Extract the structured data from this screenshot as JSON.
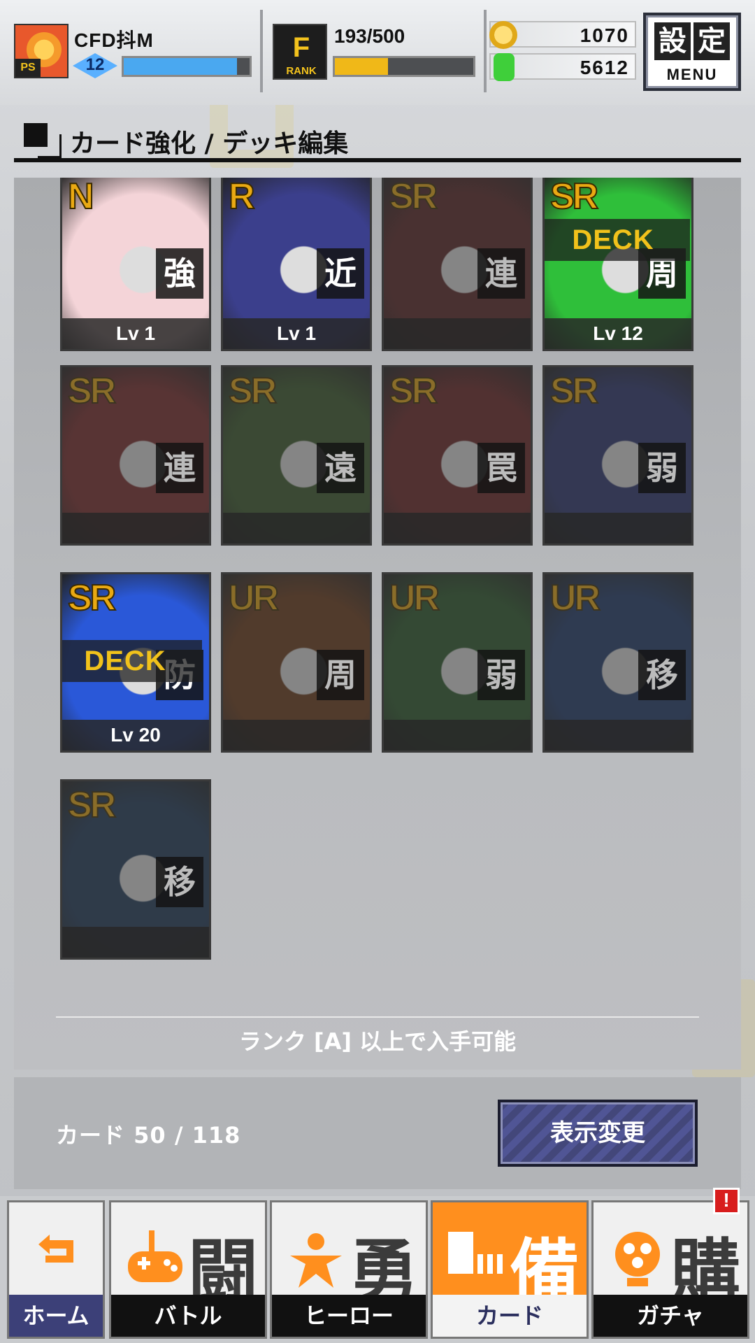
{
  "header": {
    "player_name": "CFD抖M",
    "level": "12",
    "exp_fraction": 0.9,
    "rank_progress": "193/500",
    "rank_fraction": 0.386,
    "rank_icon_letter": "F",
    "rank_icon_label": "RANK",
    "gold": "1070",
    "energy": "5612",
    "menu_kanji": [
      "設",
      "定"
    ],
    "menu_label": "MENU",
    "badge_ps": "PS"
  },
  "section": {
    "title": "カード強化 / デッキ編集"
  },
  "cards": [
    {
      "rarity": "N",
      "type": "強",
      "level": "Lv 1",
      "deck": "",
      "owned": true,
      "color": "#f4d4d8"
    },
    {
      "rarity": "R",
      "type": "近",
      "level": "Lv 1",
      "deck": "",
      "owned": true,
      "color": "#3b3f8c"
    },
    {
      "rarity": "SR",
      "type": "連",
      "level": "",
      "deck": "",
      "owned": false,
      "color": "#5a2424"
    },
    {
      "rarity": "SR",
      "type": "周",
      "level": "Lv 12",
      "deck": "DECK",
      "owned": true,
      "color": "#2fbf3a"
    },
    {
      "rarity": "SR",
      "type": "連",
      "level": "",
      "deck": "",
      "owned": false,
      "color": "#7a2a2a"
    },
    {
      "rarity": "SR",
      "type": "遠",
      "level": "",
      "deck": "",
      "owned": false,
      "color": "#3a5a2a"
    },
    {
      "rarity": "SR",
      "type": "罠",
      "level": "",
      "deck": "",
      "owned": false,
      "color": "#6a2424"
    },
    {
      "rarity": "SR",
      "type": "弱",
      "level": "",
      "deck": "",
      "owned": false,
      "color": "#2a3470"
    },
    {
      "rarity": "SR",
      "type": "防",
      "level": "Lv 20",
      "deck": "DECK",
      "owned": true,
      "color": "#2a58d8"
    },
    {
      "rarity": "UR",
      "type": "周",
      "level": "",
      "deck": "",
      "owned": false,
      "color": "#6a3a1a"
    },
    {
      "rarity": "UR",
      "type": "弱",
      "level": "",
      "deck": "",
      "owned": false,
      "color": "#2a5a2a"
    },
    {
      "rarity": "UR",
      "type": "移",
      "level": "",
      "deck": "",
      "owned": false,
      "color": "#1f3a6a"
    },
    {
      "rarity": "SR",
      "type": "移",
      "level": "",
      "deck": "",
      "owned": false,
      "color": "#1f3a5a"
    }
  ],
  "note": "ランク [A] 以上で入手可能",
  "footer": {
    "card_count": "カード 50 / 118",
    "display_button": "表示変更"
  },
  "nav": {
    "home": "ホーム",
    "battle": {
      "glyph": "闘",
      "label": "バトル"
    },
    "hero": {
      "glyph": "勇",
      "label": "ヒーロー"
    },
    "card": {
      "glyph": "備",
      "label": "カード"
    },
    "gacha": {
      "glyph": "購",
      "label": "ガチャ"
    },
    "alert": "!"
  },
  "colors": {
    "accent_orange": "#ff8f1e",
    "exp_bar": "#4aa8f0",
    "rank_bar": "#f0b818",
    "gold_coin": "#e0a818",
    "energy_can": "#3fcf3a",
    "button_navy": "#43477a"
  }
}
